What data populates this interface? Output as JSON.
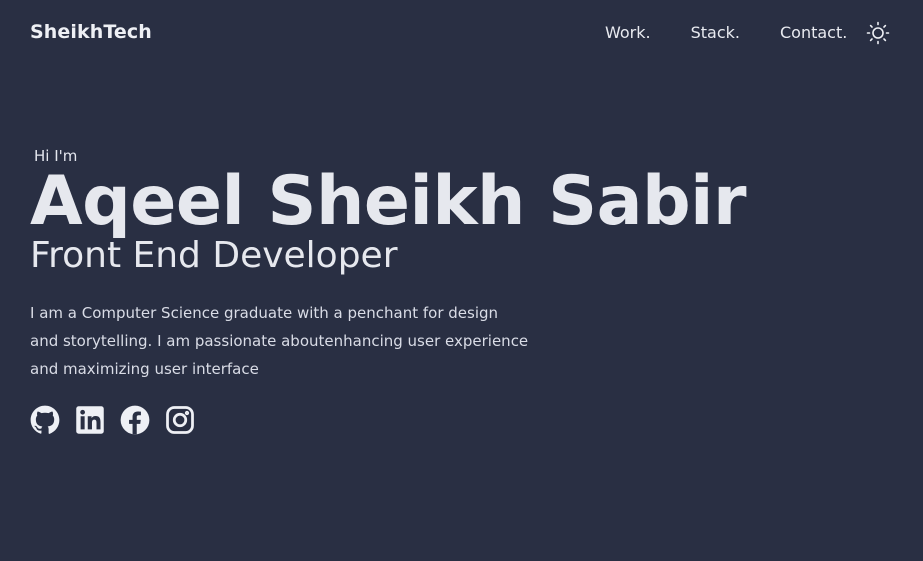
{
  "header": {
    "brand": "SheikhTech",
    "nav": [
      {
        "label": "Work."
      },
      {
        "label": "Stack."
      },
      {
        "label": "Contact."
      }
    ],
    "theme_toggle_icon": "sun-icon"
  },
  "hero": {
    "greeting": "Hi I'm",
    "name": "Aqeel Sheikh Sabir",
    "role": "Front End Developer",
    "bio": "I am a Computer Science graduate with a penchant for design and storytelling. I am passionate aboutenhancing user experience and maximizing user interface"
  },
  "socials": [
    {
      "icon": "github-icon"
    },
    {
      "icon": "linkedin-icon"
    },
    {
      "icon": "facebook-icon"
    },
    {
      "icon": "instagram-icon"
    }
  ],
  "colors": {
    "background": "#292f43",
    "text": "#e6e8ee"
  }
}
